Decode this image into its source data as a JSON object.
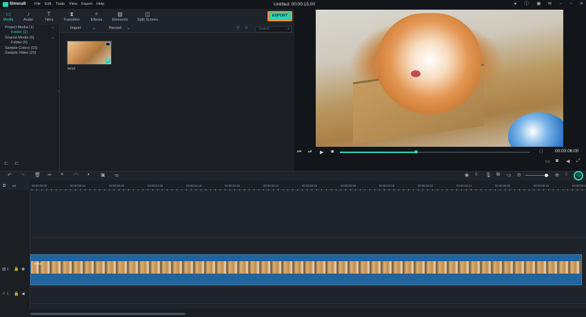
{
  "window": {
    "app_name": "filmora9",
    "title": "Untitled: 00:00:15:00",
    "menu": [
      "File",
      "Edit",
      "Tools",
      "View",
      "Export",
      "Help"
    ]
  },
  "tabs": [
    {
      "label": "Media",
      "icon": "folder-icon"
    },
    {
      "label": "Audio",
      "icon": "music-note-icon"
    },
    {
      "label": "Titles",
      "icon": "text-icon"
    },
    {
      "label": "Transition",
      "icon": "transition-icon"
    },
    {
      "label": "Effects",
      "icon": "effects-icon"
    },
    {
      "label": "Elements",
      "icon": "image-icon"
    },
    {
      "label": "Split Screen",
      "icon": "split-screen-icon"
    }
  ],
  "export_label": "EXPORT",
  "media_tree": [
    {
      "label": "Project Media (1)"
    },
    {
      "label": "Folder (1)"
    },
    {
      "label": "Shared Media (0)"
    },
    {
      "label": "Folder (0)"
    },
    {
      "label": "Sample Colors (15)"
    },
    {
      "label": "Sample Video (20)"
    }
  ],
  "media_toolbar": {
    "import_label": "Import",
    "record_label": "Record",
    "search_placeholder": "Search"
  },
  "media_items": [
    {
      "name": "tenor"
    }
  ],
  "preview": {
    "timecode": "00:00:06:00",
    "progress": 0.4,
    "brackets": "{    }"
  },
  "timeline": {
    "ruler_labels": [
      "00:00:00:00",
      "00:00:00:10",
      "00:00:00:20",
      "00:00:01:06",
      "00:00:01:16",
      "00:00:02:02",
      "00:00:02:12",
      "00:00:02:22",
      "00:00:03:08",
      "00:00:03:18",
      "00:00:04:04",
      "00:00:04:14",
      "00:00:05:00",
      "00:00:05:10",
      "00:00:05:20"
    ],
    "clip_name": "tenor",
    "video_track_label": "1",
    "audio_track_label": "1"
  },
  "colors": {
    "accent": "#2bd3b7",
    "export_border": "#f08a2c",
    "clip": "#22639c"
  }
}
